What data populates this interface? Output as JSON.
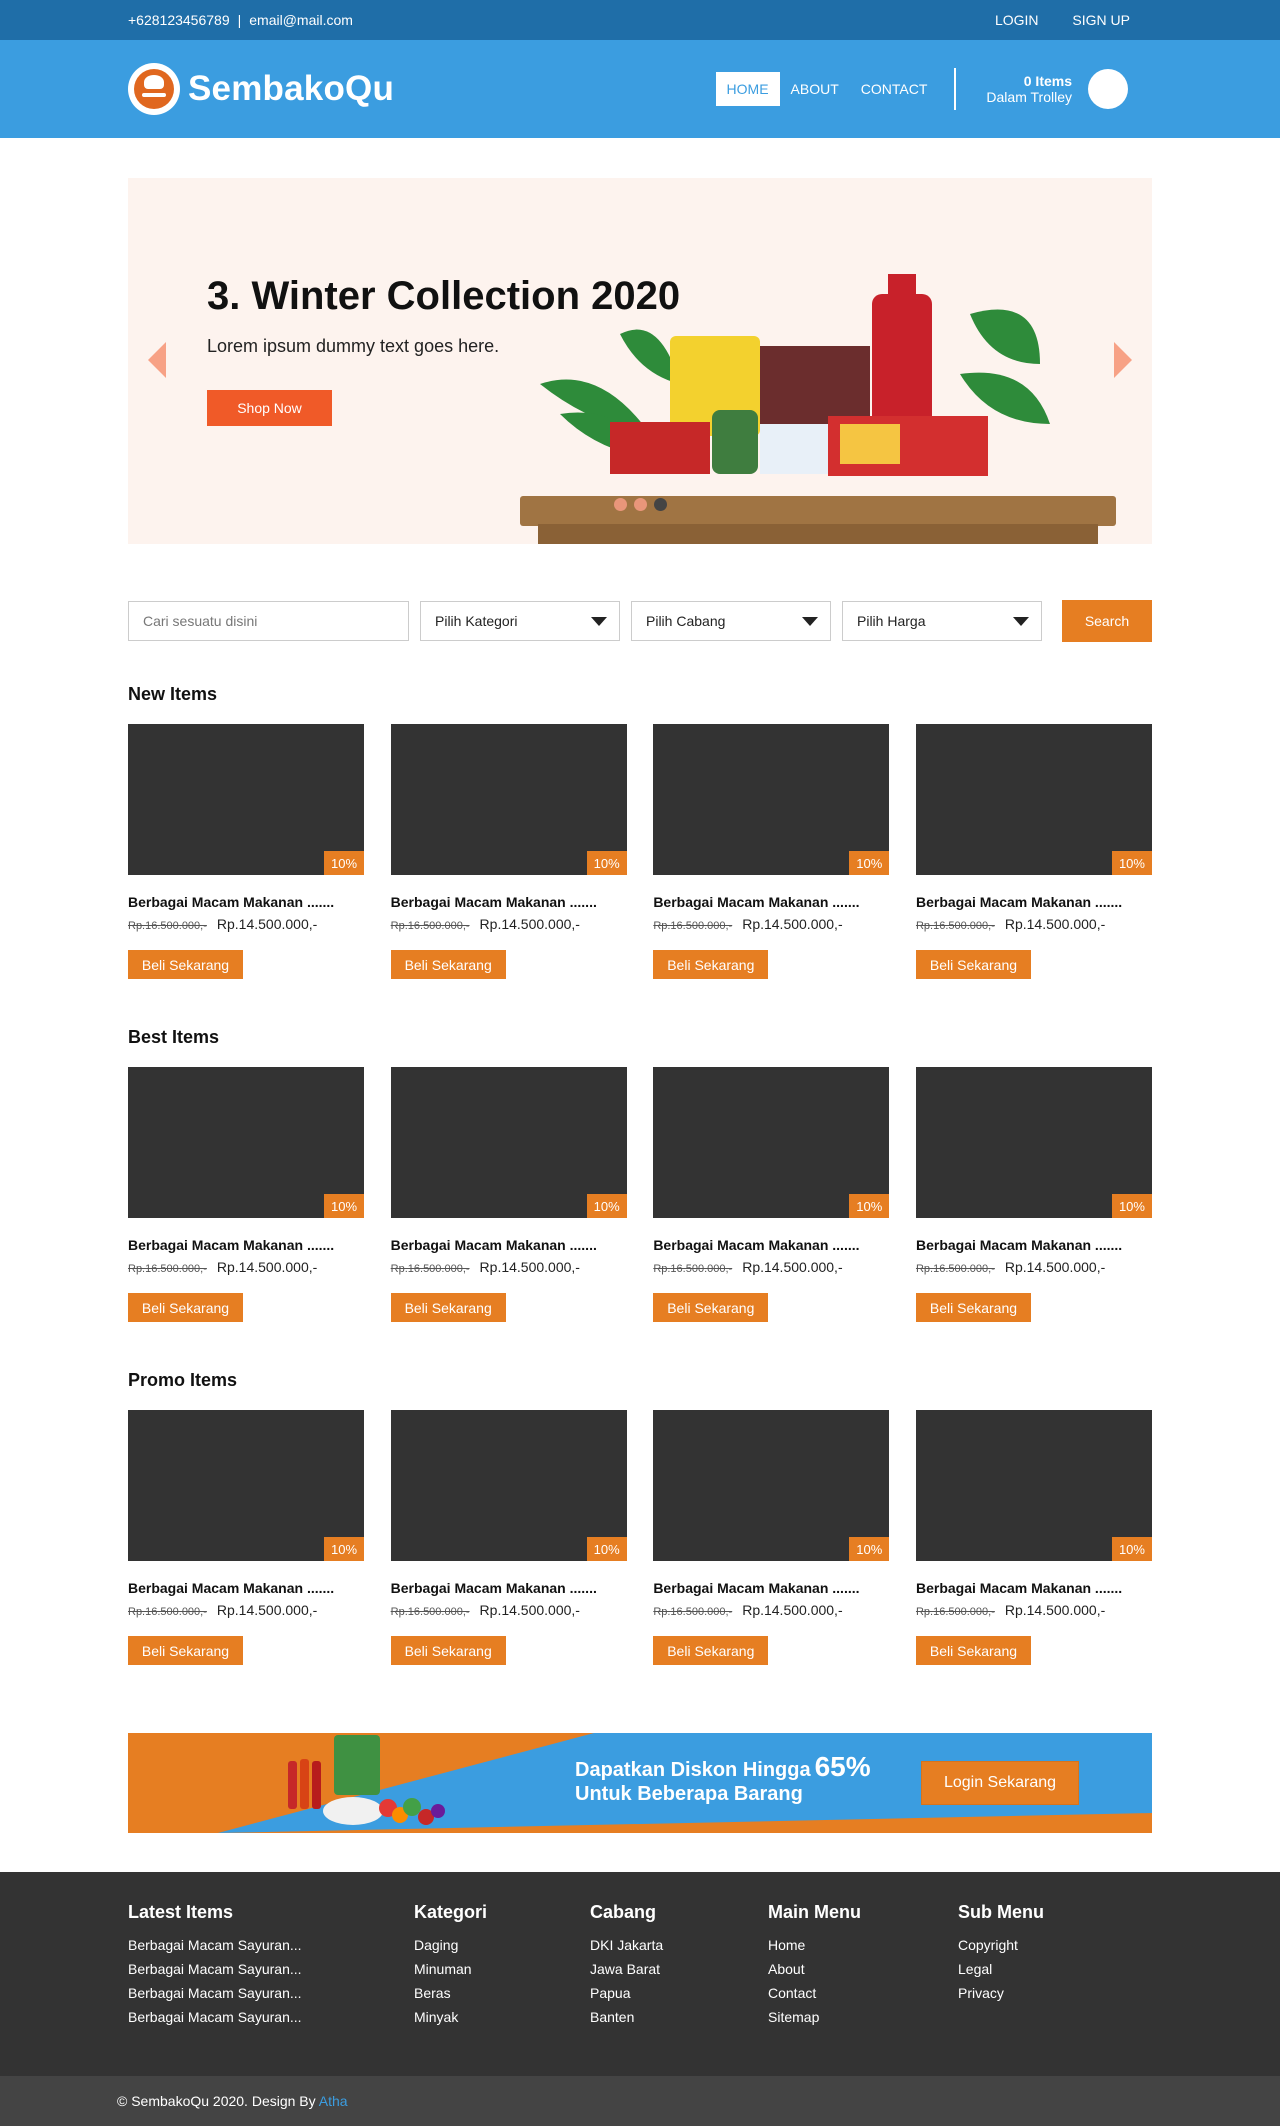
{
  "topbar": {
    "phone": "+628123456789",
    "separator": "|",
    "email": "email@mail.com",
    "login": "LOGIN",
    "signup": "SIGN UP"
  },
  "header": {
    "brand": "SembakoQu",
    "nav": [
      "HOME",
      "ABOUT",
      "CONTACT"
    ],
    "cart_count": "0 Items",
    "cart_label": "Dalam Trolley"
  },
  "slider": {
    "title": "3. Winter Collection 2020",
    "subtitle": "Lorem ipsum dummy text goes here.",
    "button": "Shop Now"
  },
  "search": {
    "placeholder": "Cari sesuatu disini",
    "category": "Pilih Kategori",
    "branch": "Pilih Cabang",
    "price": "Pilih Harga",
    "button": "Search"
  },
  "item_template": {
    "badge": "10%",
    "name": "Berbagai Macam Makanan .......",
    "old_price": "Rp.16.500.000,-",
    "price": "Rp.14.500.000,-",
    "buy": "Beli Sekarang"
  },
  "sections": {
    "new": "New Items",
    "best": "Best Items",
    "promo": "Promo Items"
  },
  "banner": {
    "line1": "Dapatkan Diskon Hingga",
    "percent": "65%",
    "line2": "Untuk Beberapa Barang",
    "button": "Login Sekarang"
  },
  "footer": {
    "latest": {
      "title": "Latest Items",
      "items": [
        "Berbagai Macam Sayuran...",
        "Berbagai Macam Sayuran...",
        "Berbagai Macam Sayuran...",
        "Berbagai Macam Sayuran..."
      ]
    },
    "kategori": {
      "title": "Kategori",
      "items": [
        "Daging",
        "Minuman",
        "Beras",
        "Minyak"
      ]
    },
    "cabang": {
      "title": "Cabang",
      "items": [
        "DKI Jakarta",
        "Jawa Barat",
        "Papua",
        "Banten"
      ]
    },
    "main_menu": {
      "title": "Main Menu",
      "items": [
        "Home",
        "About",
        "Contact",
        "Sitemap"
      ]
    },
    "sub_menu": {
      "title": "Sub Menu",
      "items": [
        "Copyright",
        "Legal",
        "Privacy"
      ]
    },
    "copyright": "© SembakoQu 2020. Design By",
    "designer": "Atha"
  }
}
